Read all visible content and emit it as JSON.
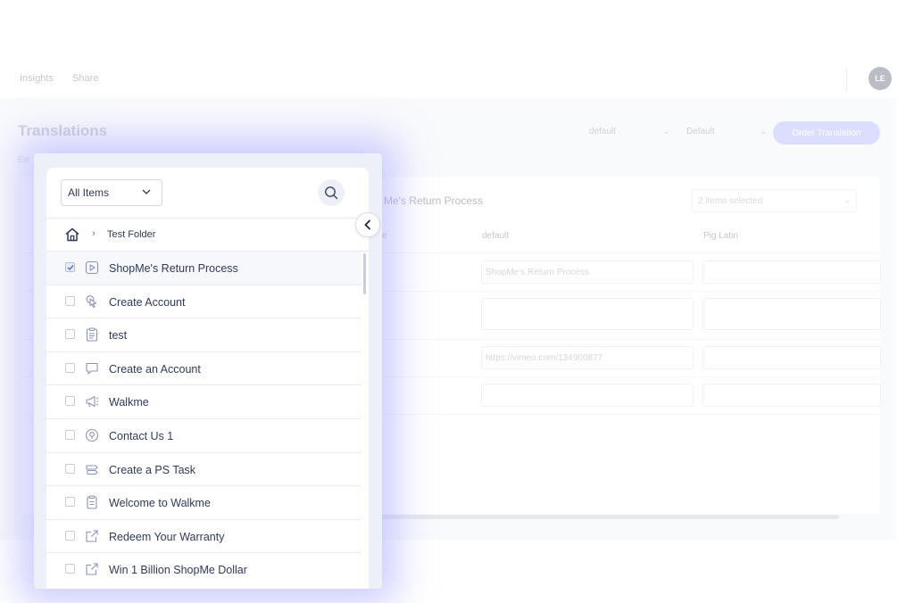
{
  "topnav": {
    "links": [
      "Insights",
      "Share"
    ],
    "avatar_initials": "LE"
  },
  "page": {
    "title": "Translations",
    "edit_text": "Edi",
    "language_select": "default",
    "segment_select": "Default",
    "order_button": "Order Translation"
  },
  "content_panel": {
    "title": "Me's Return Process",
    "items_selected": "2 items selected",
    "columns": [
      "e",
      "default",
      "Pig Latin"
    ],
    "rows": [
      {
        "default": "ShopMe's Return Process",
        "pig_latin": ""
      },
      {
        "default": "",
        "pig_latin": ""
      },
      {
        "default": "https://vimeo.com/134900877",
        "pig_latin": ""
      },
      {
        "default": "",
        "pig_latin": ""
      }
    ]
  },
  "picker": {
    "filter": "All Items",
    "breadcrumb_folder": "Test Folder",
    "items": [
      {
        "label": "ShopMe's Return Process",
        "icon": "play-icon",
        "checked": true
      },
      {
        "label": "Create Account",
        "icon": "pointer-hand-icon",
        "checked": false
      },
      {
        "label": "test",
        "icon": "clipboard-list-icon",
        "checked": false
      },
      {
        "label": "Create an Account",
        "icon": "chat-bubble-icon",
        "checked": false
      },
      {
        "label": "Walkme",
        "icon": "megaphone-icon",
        "checked": false
      },
      {
        "label": "Contact Us 1",
        "icon": "target-circle-icon",
        "checked": false
      },
      {
        "label": "Create a PS Task",
        "icon": "stack-task-icon",
        "checked": false
      },
      {
        "label": "Welcome to Walkme",
        "icon": "clipboard-icon",
        "checked": false
      },
      {
        "label": "Redeem Your Warranty",
        "icon": "external-link-icon",
        "checked": false
      },
      {
        "label": "Win 1 Billion ShopMe Dollar",
        "icon": "external-link-icon",
        "checked": false
      }
    ]
  },
  "colors": {
    "accent": "#aab4ff",
    "text": "#2f3a59",
    "glow": "#a0a0ff"
  }
}
